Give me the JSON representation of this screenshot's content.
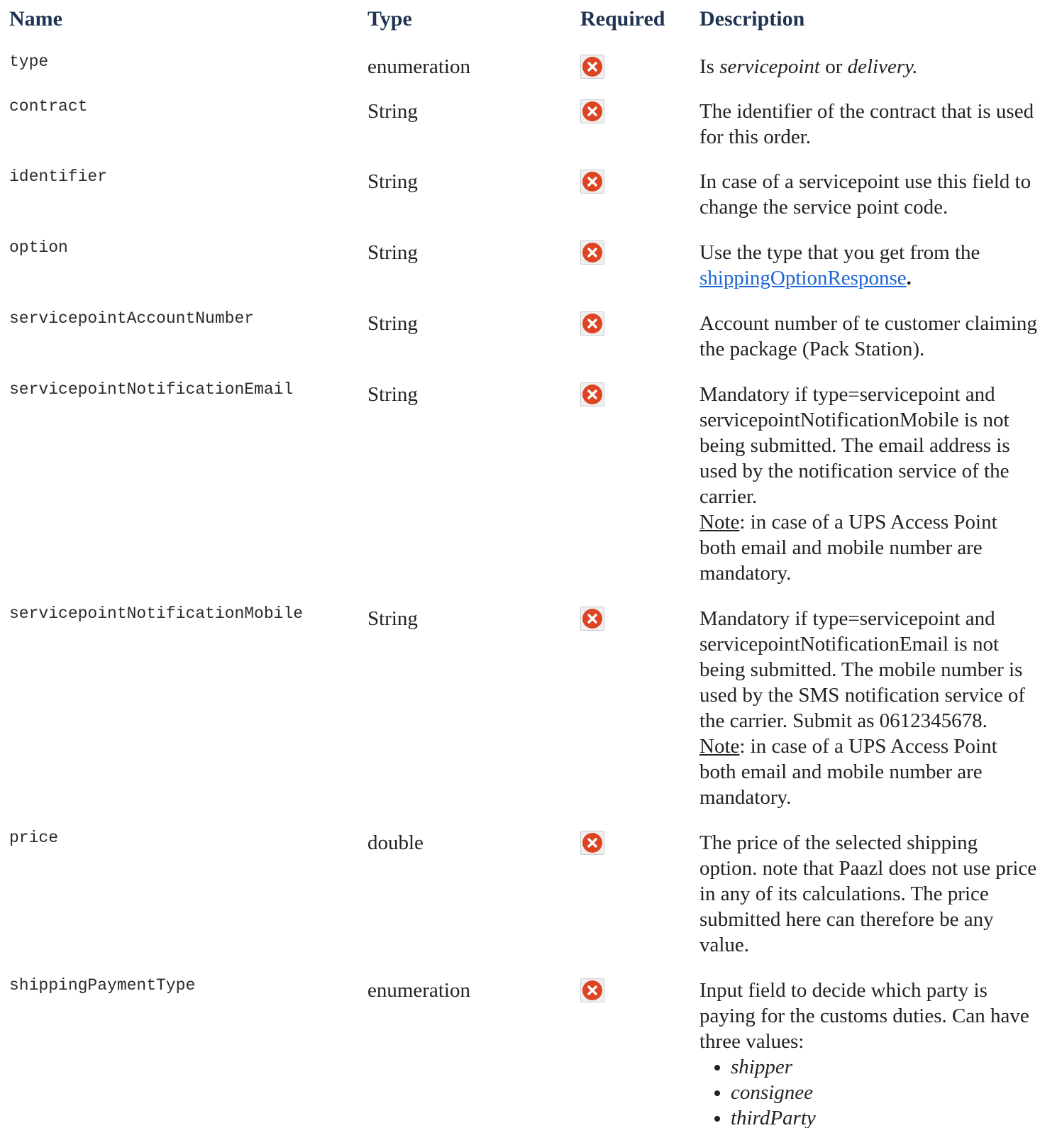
{
  "headers": {
    "name": "Name",
    "type": "Type",
    "required": "Required",
    "description": "Description"
  },
  "rows": [
    {
      "name": "type",
      "type": "enumeration",
      "required_icon": "error-x-icon",
      "desc_prefix": "Is ",
      "desc_em1": "servicepoint",
      "desc_mid": " or ",
      "desc_em2": "delivery."
    },
    {
      "name": "contract",
      "type": "String",
      "required_icon": "error-x-icon",
      "desc_lines": [
        "The identifier of the contract that is used",
        "for this order."
      ]
    },
    {
      "name": "identifier",
      "type": "String",
      "required_icon": "error-x-icon",
      "desc_lines": [
        "In case of a servicepoint use this field to",
        "change the service point code."
      ]
    },
    {
      "name": "option",
      "type": "String",
      "required_icon": "error-x-icon",
      "desc_line1": "Use the type that you get from the",
      "desc_link": "shippingOptionResponse",
      "desc_link_suffix": "."
    },
    {
      "name": "servicepointAccountNumber",
      "type": "String",
      "required_icon": "error-x-icon",
      "desc_lines": [
        "Account number of te customer claiming",
        "the package (Pack Station)."
      ]
    },
    {
      "name": "servicepointNotificationEmail",
      "type": "String",
      "required_icon": "error-x-icon",
      "desc_lines": [
        "Mandatory if type=servicepoint and",
        "servicepointNotificationMobile is not",
        "being submitted. The email address is",
        "used by the notification service of the",
        "carrier."
      ],
      "note_label": "Note",
      "note_lines": [
        ": in case of a UPS Access Point",
        "both email and mobile number are",
        "mandatory."
      ]
    },
    {
      "name": "servicepointNotificationMobile",
      "type": "String",
      "required_icon": "error-x-icon",
      "desc_lines": [
        "Mandatory if type=servicepoint and",
        "servicepointNotificationEmail is not",
        "being submitted. The mobile number is",
        "used by the SMS notification service of",
        "the carrier. Submit as 0612345678."
      ],
      "note_label": "Note",
      "note_lines": [
        ": in case of a UPS Access Point",
        "both email and mobile number are",
        "mandatory."
      ]
    },
    {
      "name": "price",
      "type": "double",
      "required_icon": "error-x-icon",
      "desc_lines": [
        "The price of the selected shipping",
        "option. note that Paazl does not use price",
        "in any of its calculations. The price",
        "submitted here can therefore be any",
        "value."
      ]
    },
    {
      "name": "shippingPaymentType",
      "type": "enumeration",
      "required_icon": "error-x-icon",
      "desc_lines": [
        "Input field to decide which party is",
        "paying for the customs duties. Can have",
        "three values:"
      ],
      "values": [
        "shipper",
        "consignee",
        "thirdParty"
      ]
    }
  ],
  "colors": {
    "header": "#1f3352",
    "icon_red": "#dd4422",
    "link": "#1c66d4"
  }
}
